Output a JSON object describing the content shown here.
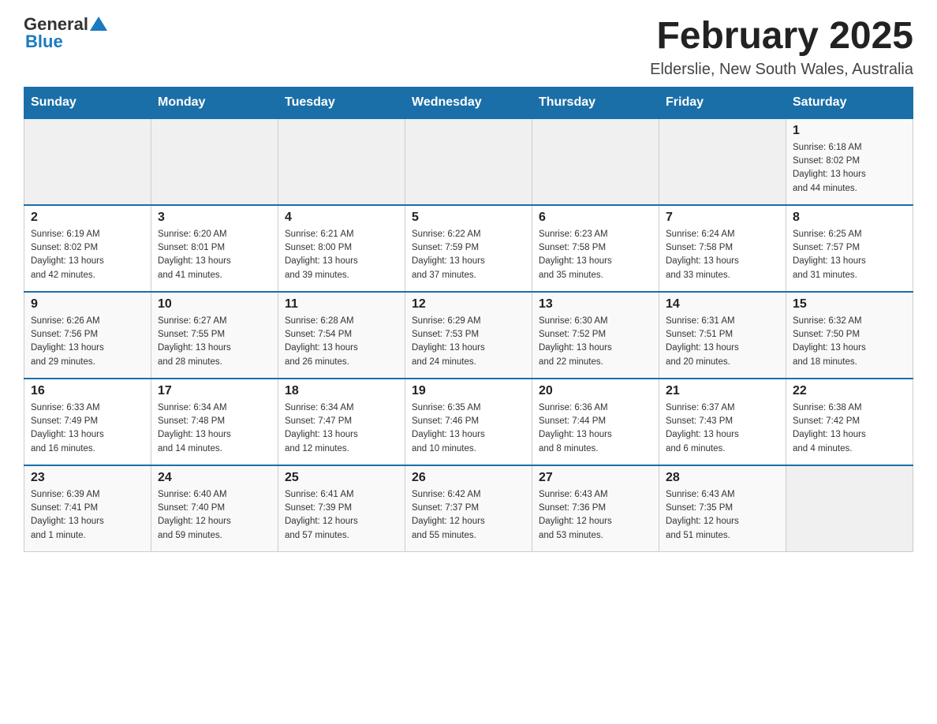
{
  "header": {
    "logo_general": "General",
    "logo_blue": "Blue",
    "month_title": "February 2025",
    "location": "Elderslie, New South Wales, Australia"
  },
  "days_of_week": [
    "Sunday",
    "Monday",
    "Tuesday",
    "Wednesday",
    "Thursday",
    "Friday",
    "Saturday"
  ],
  "weeks": [
    [
      {
        "day": "",
        "info": ""
      },
      {
        "day": "",
        "info": ""
      },
      {
        "day": "",
        "info": ""
      },
      {
        "day": "",
        "info": ""
      },
      {
        "day": "",
        "info": ""
      },
      {
        "day": "",
        "info": ""
      },
      {
        "day": "1",
        "info": "Sunrise: 6:18 AM\nSunset: 8:02 PM\nDaylight: 13 hours\nand 44 minutes."
      }
    ],
    [
      {
        "day": "2",
        "info": "Sunrise: 6:19 AM\nSunset: 8:02 PM\nDaylight: 13 hours\nand 42 minutes."
      },
      {
        "day": "3",
        "info": "Sunrise: 6:20 AM\nSunset: 8:01 PM\nDaylight: 13 hours\nand 41 minutes."
      },
      {
        "day": "4",
        "info": "Sunrise: 6:21 AM\nSunset: 8:00 PM\nDaylight: 13 hours\nand 39 minutes."
      },
      {
        "day": "5",
        "info": "Sunrise: 6:22 AM\nSunset: 7:59 PM\nDaylight: 13 hours\nand 37 minutes."
      },
      {
        "day": "6",
        "info": "Sunrise: 6:23 AM\nSunset: 7:58 PM\nDaylight: 13 hours\nand 35 minutes."
      },
      {
        "day": "7",
        "info": "Sunrise: 6:24 AM\nSunset: 7:58 PM\nDaylight: 13 hours\nand 33 minutes."
      },
      {
        "day": "8",
        "info": "Sunrise: 6:25 AM\nSunset: 7:57 PM\nDaylight: 13 hours\nand 31 minutes."
      }
    ],
    [
      {
        "day": "9",
        "info": "Sunrise: 6:26 AM\nSunset: 7:56 PM\nDaylight: 13 hours\nand 29 minutes."
      },
      {
        "day": "10",
        "info": "Sunrise: 6:27 AM\nSunset: 7:55 PM\nDaylight: 13 hours\nand 28 minutes."
      },
      {
        "day": "11",
        "info": "Sunrise: 6:28 AM\nSunset: 7:54 PM\nDaylight: 13 hours\nand 26 minutes."
      },
      {
        "day": "12",
        "info": "Sunrise: 6:29 AM\nSunset: 7:53 PM\nDaylight: 13 hours\nand 24 minutes."
      },
      {
        "day": "13",
        "info": "Sunrise: 6:30 AM\nSunset: 7:52 PM\nDaylight: 13 hours\nand 22 minutes."
      },
      {
        "day": "14",
        "info": "Sunrise: 6:31 AM\nSunset: 7:51 PM\nDaylight: 13 hours\nand 20 minutes."
      },
      {
        "day": "15",
        "info": "Sunrise: 6:32 AM\nSunset: 7:50 PM\nDaylight: 13 hours\nand 18 minutes."
      }
    ],
    [
      {
        "day": "16",
        "info": "Sunrise: 6:33 AM\nSunset: 7:49 PM\nDaylight: 13 hours\nand 16 minutes."
      },
      {
        "day": "17",
        "info": "Sunrise: 6:34 AM\nSunset: 7:48 PM\nDaylight: 13 hours\nand 14 minutes."
      },
      {
        "day": "18",
        "info": "Sunrise: 6:34 AM\nSunset: 7:47 PM\nDaylight: 13 hours\nand 12 minutes."
      },
      {
        "day": "19",
        "info": "Sunrise: 6:35 AM\nSunset: 7:46 PM\nDaylight: 13 hours\nand 10 minutes."
      },
      {
        "day": "20",
        "info": "Sunrise: 6:36 AM\nSunset: 7:44 PM\nDaylight: 13 hours\nand 8 minutes."
      },
      {
        "day": "21",
        "info": "Sunrise: 6:37 AM\nSunset: 7:43 PM\nDaylight: 13 hours\nand 6 minutes."
      },
      {
        "day": "22",
        "info": "Sunrise: 6:38 AM\nSunset: 7:42 PM\nDaylight: 13 hours\nand 4 minutes."
      }
    ],
    [
      {
        "day": "23",
        "info": "Sunrise: 6:39 AM\nSunset: 7:41 PM\nDaylight: 13 hours\nand 1 minute."
      },
      {
        "day": "24",
        "info": "Sunrise: 6:40 AM\nSunset: 7:40 PM\nDaylight: 12 hours\nand 59 minutes."
      },
      {
        "day": "25",
        "info": "Sunrise: 6:41 AM\nSunset: 7:39 PM\nDaylight: 12 hours\nand 57 minutes."
      },
      {
        "day": "26",
        "info": "Sunrise: 6:42 AM\nSunset: 7:37 PM\nDaylight: 12 hours\nand 55 minutes."
      },
      {
        "day": "27",
        "info": "Sunrise: 6:43 AM\nSunset: 7:36 PM\nDaylight: 12 hours\nand 53 minutes."
      },
      {
        "day": "28",
        "info": "Sunrise: 6:43 AM\nSunset: 7:35 PM\nDaylight: 12 hours\nand 51 minutes."
      },
      {
        "day": "",
        "info": ""
      }
    ]
  ]
}
